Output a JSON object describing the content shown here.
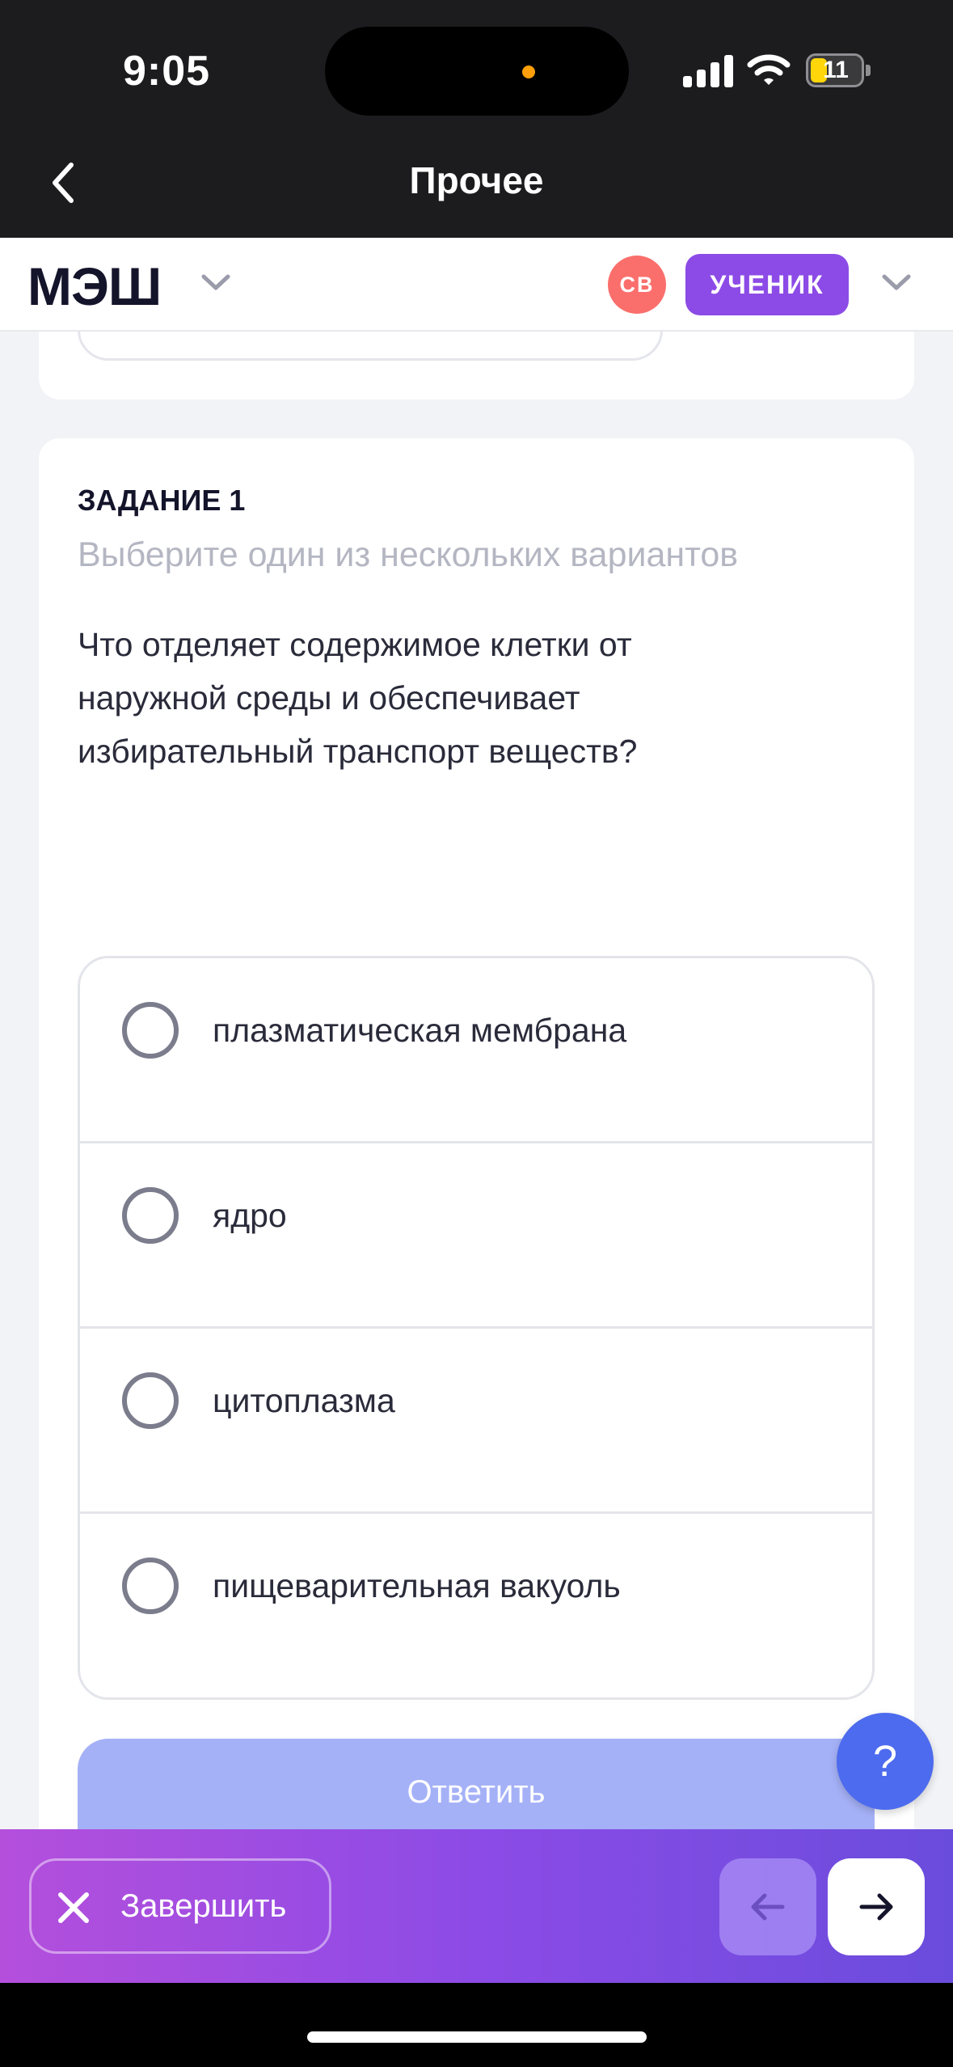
{
  "status_bar": {
    "time": "9:05",
    "battery": "11",
    "icons": [
      "signal-icon",
      "wifi-icon",
      "battery-icon"
    ]
  },
  "nav": {
    "title": "Прочее",
    "back_icon": "chevron-left-icon"
  },
  "app_header": {
    "logo": "МЭШ",
    "avatar_initials": "СВ",
    "role": "УЧЕНИК",
    "accent_color": "#8c4be6",
    "avatar_color": "#fa6f6c"
  },
  "task": {
    "label": "ЗАДАНИЕ 1",
    "hint": "Выберите один из нескольких вариантов",
    "question": "Что отделяет содержимое клетки от наружной среды и обеспечивает избирательный транспорт веществ?",
    "options": [
      {
        "text": "плазматическая мембрана",
        "selected": false
      },
      {
        "text": "ядро",
        "selected": false
      },
      {
        "text": "цитоплазма",
        "selected": false
      },
      {
        "text": "пищеварительная вакуоль",
        "selected": false
      }
    ],
    "answer_label": "Ответить",
    "answer_enabled": false
  },
  "help": {
    "label": "?"
  },
  "bottom_bar": {
    "finish_label": "Завершить",
    "prev_icon": "arrow-left-icon",
    "next_icon": "arrow-right-icon",
    "prev_enabled": false,
    "next_enabled": true
  }
}
